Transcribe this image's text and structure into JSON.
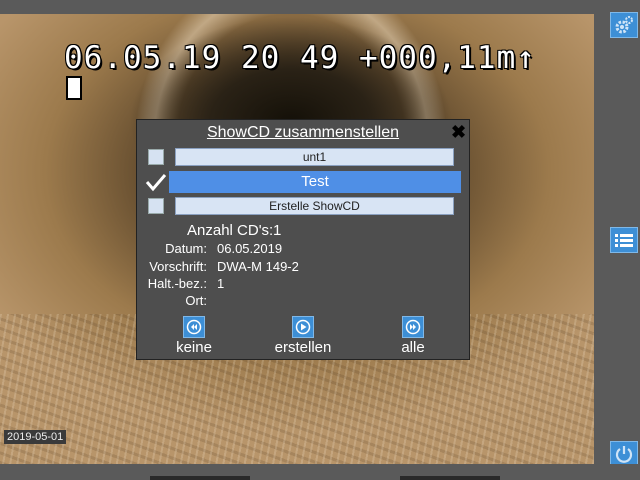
{
  "overlay": {
    "text": "06.05.19 20 49 +000,11m↑",
    "date_stamp": "2019-05-01"
  },
  "side_buttons": {
    "settings_icon": "gears-icon",
    "menu_icon": "list-icon",
    "power_icon": "power-icon"
  },
  "dialog": {
    "title": "ShowCD zusammenstellen",
    "close_label": "✖",
    "items": [
      {
        "label": "unt1",
        "checked": false
      },
      {
        "label": "Test",
        "checked": true
      },
      {
        "label": "Erstelle ShowCD",
        "checked": false
      }
    ],
    "count_label": "Anzahl CD's:",
    "count_value": "1",
    "fields": [
      {
        "label": "Datum:",
        "value": "06.05.2019"
      },
      {
        "label": "Vorschrift:",
        "value": "DWA-M 149-2"
      },
      {
        "label": "Halt.-bez.:",
        "value": "1"
      },
      {
        "label": "Ort:",
        "value": ""
      }
    ],
    "actions": [
      {
        "label": "keine",
        "icon": "rewind-icon"
      },
      {
        "label": "erstellen",
        "icon": "play-icon"
      },
      {
        "label": "alle",
        "icon": "fast-forward-icon"
      }
    ]
  },
  "colors": {
    "accent": "#3d8fd6",
    "selection": "#4f8fe6",
    "dialog_bg": "#4e4e4e"
  }
}
